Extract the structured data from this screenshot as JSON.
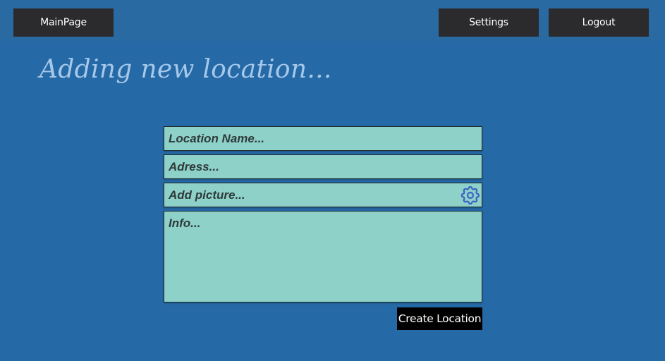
{
  "nav": {
    "main_label": "MainPage",
    "settings_label": "Settings",
    "logout_label": "Logout"
  },
  "page": {
    "title": "Adding new location..."
  },
  "form": {
    "name_placeholder": "Location Name...",
    "address_placeholder": "Adress...",
    "picture_label": "Add picture...",
    "picture_icon": "gear-icon",
    "info_placeholder": "Info...",
    "submit_label": "Create Location"
  },
  "colors": {
    "background": "#2569a6",
    "nav_button": "#2b2b2e",
    "title": "#a6c8ea",
    "field": "#8ed1c9",
    "icon": "#3d5fc4",
    "submit_button": "#000000"
  }
}
